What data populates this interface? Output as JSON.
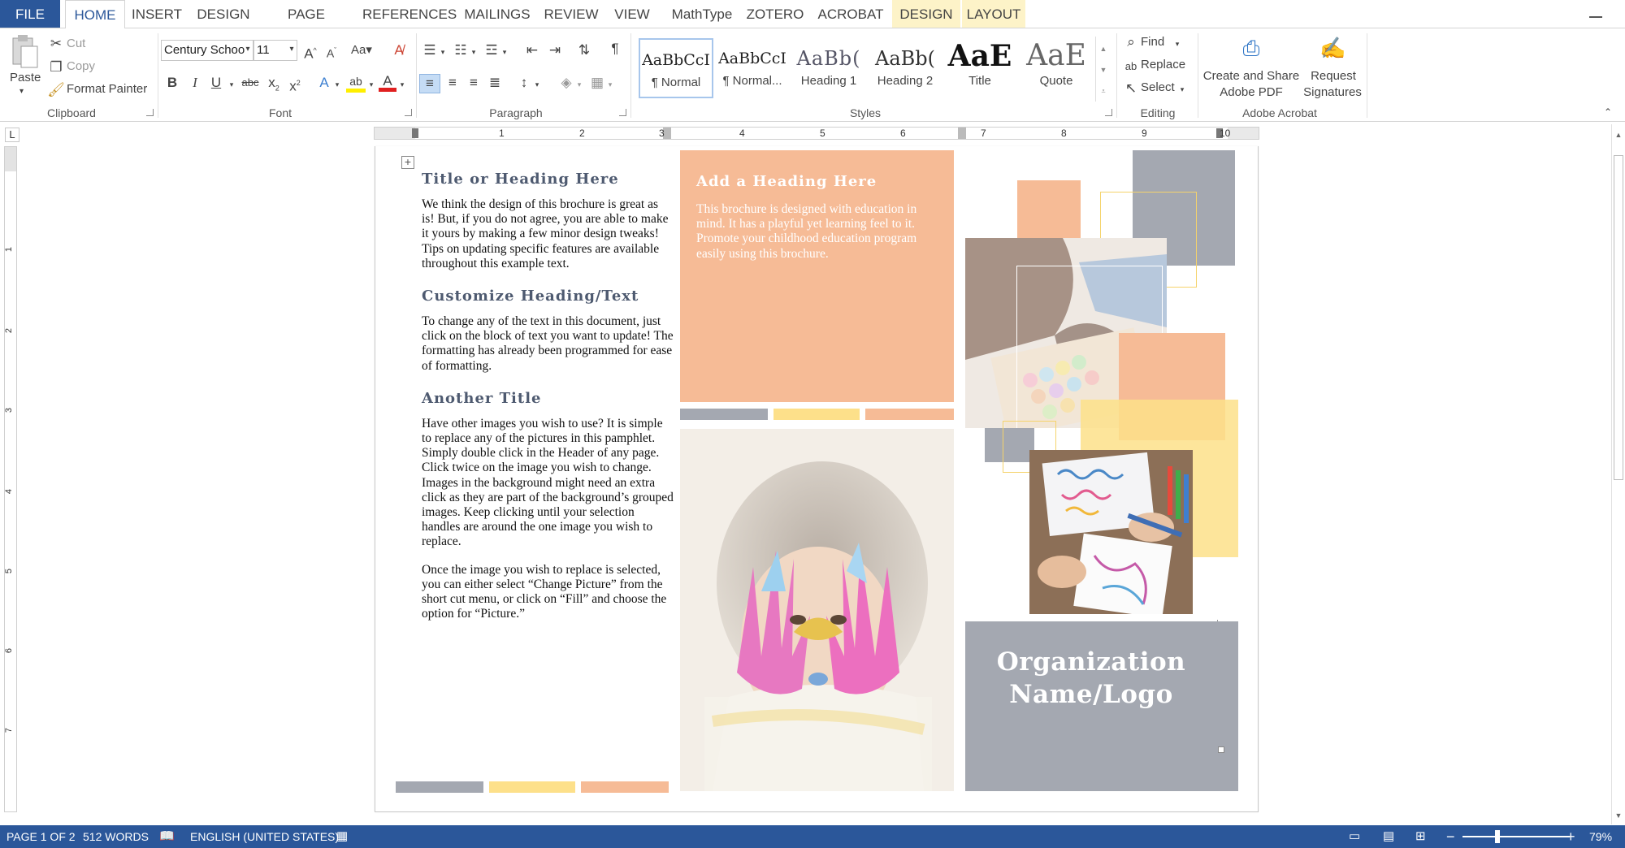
{
  "tabs": {
    "file": "FILE",
    "home": "HOME",
    "insert": "INSERT",
    "design": "DESIGN",
    "page_layout": "PAGE LAYOUT",
    "references": "REFERENCES",
    "mailings": "MAILINGS",
    "review": "REVIEW",
    "view": "VIEW",
    "mathtype": "MathType",
    "zotero": "ZOTERO",
    "acrobat": "ACROBAT",
    "design2": "DESIGN",
    "layout": "LAYOUT"
  },
  "clipboard": {
    "paste": "Paste",
    "cut": "Cut",
    "copy": "Copy",
    "format_painter": "Format Painter",
    "label": "Clipboard"
  },
  "font": {
    "name": "Century Schoo",
    "size": "11",
    "change_case": "Aa",
    "label": "Font"
  },
  "paragraph": {
    "label": "Paragraph"
  },
  "styles": {
    "label": "Styles",
    "items": [
      {
        "sample": "AaBbCcI",
        "name": "¶ Normal"
      },
      {
        "sample": "AaBbCcI",
        "name": "¶ Normal..."
      },
      {
        "sample": "AaBb(",
        "name": "Heading 1"
      },
      {
        "sample": "AaBb(",
        "name": "Heading 2"
      },
      {
        "sample": "AaE",
        "name": "Title"
      },
      {
        "sample": "AaE",
        "name": "Quote"
      }
    ]
  },
  "editing": {
    "find": "Find",
    "replace": "Replace",
    "select": "Select",
    "label": "Editing"
  },
  "acrobat": {
    "create_share": "Create and Share",
    "adobe_pdf": "Adobe PDF",
    "request": "Request",
    "signatures": "Signatures",
    "label": "Adobe Acrobat"
  },
  "ruler": {
    "h": [
      "1",
      "2",
      "3",
      "4",
      "5",
      "6",
      "7",
      "8",
      "9",
      "10"
    ],
    "v": [
      "1",
      "2",
      "3",
      "4",
      "5",
      "6",
      "7"
    ]
  },
  "doc": {
    "h1": "Title or Heading Here",
    "p1": "We think the design of this brochure is great as is!  But, if you do not agree, you are able to make it yours by making a few minor design tweaks!  Tips on updating specific features are available throughout this example text.",
    "h2": "Customize Heading/Text",
    "p2": "To change any of the text in this document, just click on the block of text you want to update!  The formatting has already been programmed for ease of formatting.",
    "h3": "Another Title",
    "p3": "Have other images you wish to use?  It is simple to replace any of the pictures in this pamphlet.  Simply double click in the Header of any page.  Click twice on the image you wish to change.  Images in the background might need an extra click as they are part of the background’s grouped images.  Keep clicking until your selection handles are around the one image you wish to replace.",
    "p4": "Once the image you wish to replace is selected, you can either select “Change Picture” from the short cut menu, or click on “Fill” and choose the option for “Picture.”",
    "h4": "Add a Heading Here",
    "p5": "This brochure is designed with education in mind.  It has a playful yet learning feel to it.  Promote your childhood education program easily using this brochure.",
    "org_line1": "Organization",
    "org_line2": "Name/Logo"
  },
  "status": {
    "page": "PAGE 1 OF 2",
    "words": "512 WORDS",
    "language": "ENGLISH (UNITED STATES)",
    "zoom": "79%"
  },
  "colors": {
    "accent": "#2b579a",
    "peach": "#f6bb96",
    "yellow": "#fde08a",
    "slate": "#a4a8b1"
  }
}
